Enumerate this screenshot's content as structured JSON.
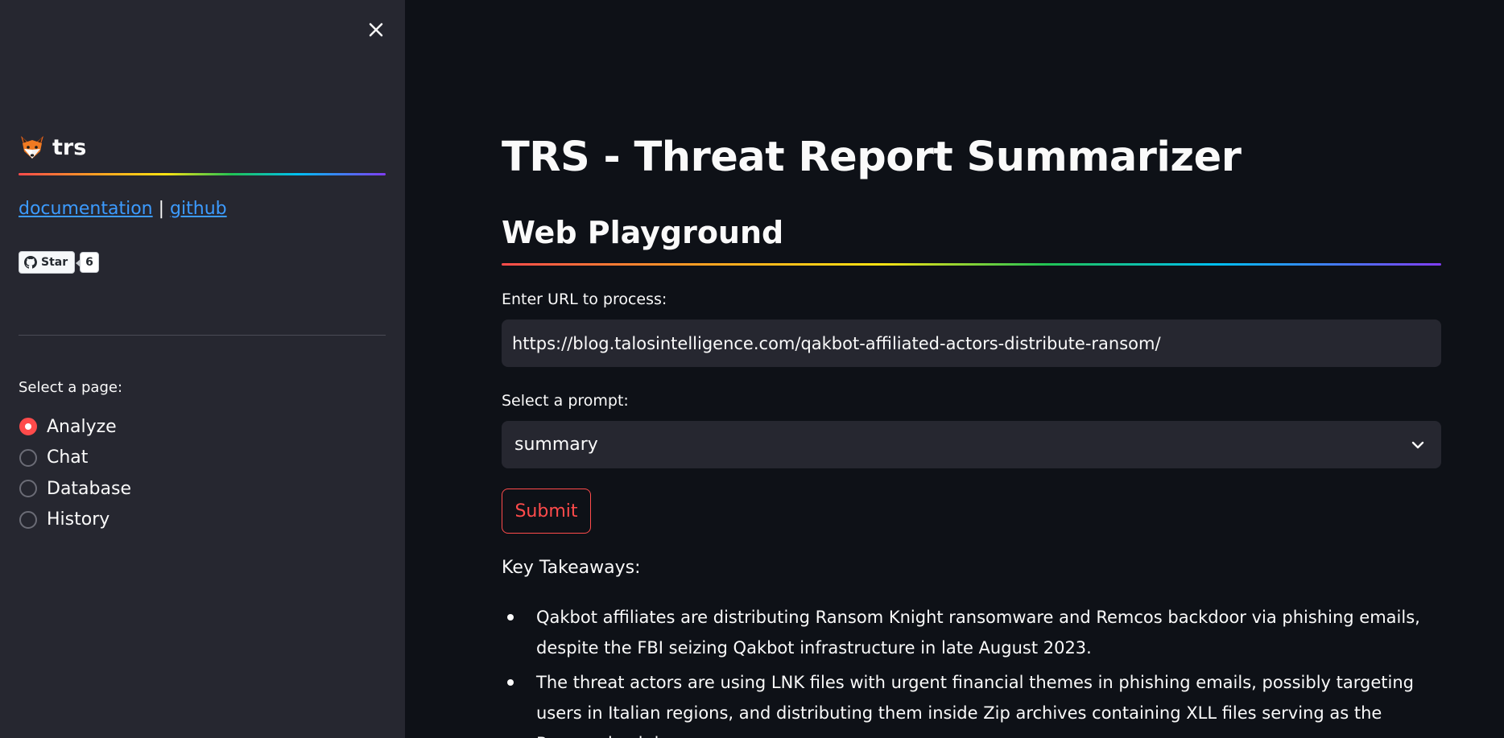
{
  "sidebar": {
    "brand": "trs",
    "links": {
      "documentation": "documentation",
      "separator": "|",
      "github": "github"
    },
    "github_button": {
      "label": "Star",
      "count": "6"
    },
    "select_label": "Select a page:",
    "pages": [
      {
        "label": "Analyze",
        "selected": true
      },
      {
        "label": "Chat",
        "selected": false
      },
      {
        "label": "Database",
        "selected": false
      },
      {
        "label": "History",
        "selected": false
      }
    ]
  },
  "main": {
    "title": "TRS - Threat Report Summarizer",
    "subtitle": "Web Playground",
    "url_label": "Enter URL to process:",
    "url_value": "https://blog.talosintelligence.com/qakbot-affiliated-actors-distribute-ransom/",
    "prompt_label": "Select a prompt:",
    "prompt_value": "summary",
    "submit_label": "Submit",
    "takeaways_label": "Key Takeaways:",
    "takeaways": [
      "Qakbot affiliates are distributing Ransom Knight ransomware and Remcos backdoor via phishing emails, despite the FBI seizing Qakbot infrastructure in late August 2023.",
      "The threat actors are using LNK files with urgent financial themes in phishing emails, possibly targeting users in Italian regions, and distributing them inside Zip archives containing XLL files serving as the Remcos backdoor."
    ]
  },
  "colors": {
    "background": "#0e1117",
    "sidebar": "#262730",
    "accent": "#ff4b4b",
    "link": "#3c9bff"
  }
}
